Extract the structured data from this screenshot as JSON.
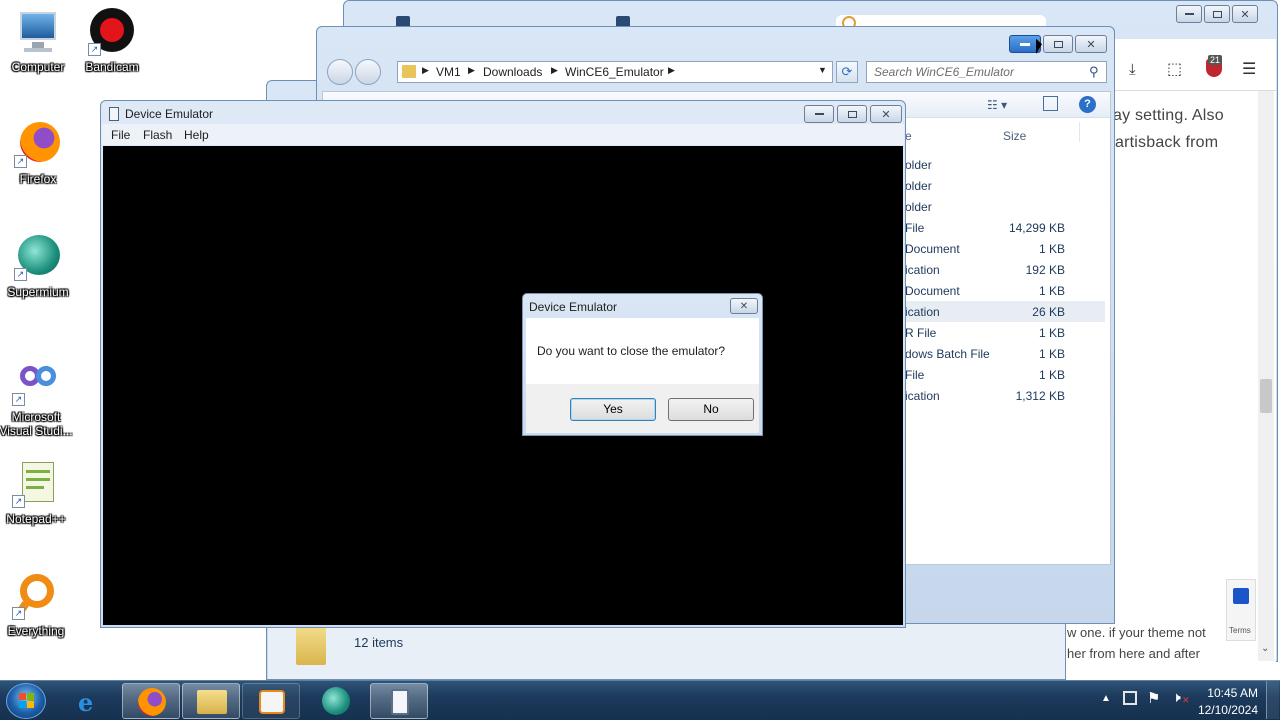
{
  "desktop": {
    "icons": [
      {
        "label": "Computer"
      },
      {
        "label": "Bandicam"
      },
      {
        "label": "Firefox"
      },
      {
        "label": "Supermium"
      },
      {
        "label": "Microsoft Visual Studi..."
      },
      {
        "label": "Notepad++"
      },
      {
        "label": "Everything"
      }
    ]
  },
  "browser": {
    "page_text": {
      "line1": "ay setting. Also",
      "line2": "artisback  from",
      "line3": "w one. if your theme not",
      "line4": "her from here and after"
    },
    "badge_count": "21",
    "recaptcha_terms": "Terms"
  },
  "explorer": {
    "address": {
      "crumbs": [
        "VM1",
        "Downloads",
        "WinCE6_Emulator"
      ]
    },
    "search_placeholder": "Search WinCE6_Emulator",
    "columns": {
      "name_partial": "e",
      "size": "Size"
    },
    "rows": [
      {
        "type": "older",
        "size": ""
      },
      {
        "type": "older",
        "size": ""
      },
      {
        "type": "older",
        "size": ""
      },
      {
        "type": "File",
        "size": "14,299 KB"
      },
      {
        "type": "Document",
        "size": "1 KB"
      },
      {
        "type": "ication",
        "size": "192 KB"
      },
      {
        "type": "Document",
        "size": "1 KB"
      },
      {
        "type": "ication",
        "size": "26 KB"
      },
      {
        "type": "R File",
        "size": "1 KB"
      },
      {
        "type": "dows Batch File",
        "size": "1 KB"
      },
      {
        "type": "File",
        "size": "1 KB"
      },
      {
        "type": "ication",
        "size": "1,312 KB"
      }
    ],
    "status": "12 items"
  },
  "emulator": {
    "title": "Device Emulator",
    "menu": [
      "File",
      "Flash",
      "Help"
    ]
  },
  "dialog": {
    "title": "Device Emulator",
    "message": "Do you want to close the emulator?",
    "yes": "Yes",
    "no": "No"
  },
  "taskbar": {
    "time": "10:45 AM",
    "date": "12/10/2024"
  }
}
